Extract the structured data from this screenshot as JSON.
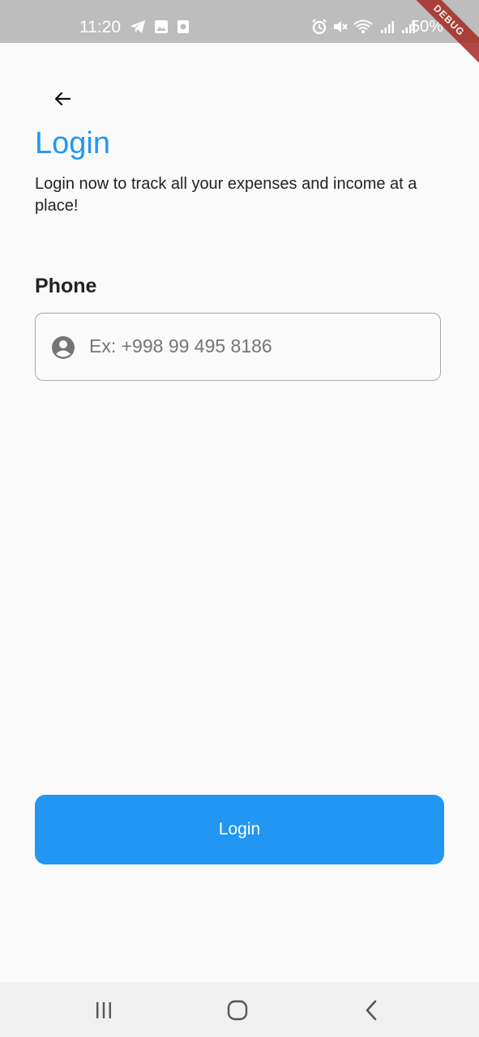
{
  "status_bar": {
    "time": "11:20",
    "battery": "50%",
    "debug_banner": "DEBUG",
    "left_icons": [
      "telegram-icon",
      "gallery-icon",
      "app-notification-icon"
    ],
    "right_icons": [
      "alarm-icon",
      "mute-icon",
      "wifi-icon",
      "signal-icon",
      "signal-icon"
    ]
  },
  "header": {
    "back_icon": "arrow-left-icon",
    "title": "Login",
    "subtitle": "Login now to track all your expenses and income at a place!"
  },
  "form": {
    "phone_label": "Phone",
    "phone_icon": "person-circle-icon",
    "phone_placeholder": "Ex: +998 99 495 8186",
    "phone_value": ""
  },
  "actions": {
    "login_label": "Login"
  },
  "nav_bar": {
    "buttons": [
      "recent-apps-icon",
      "home-icon",
      "back-icon"
    ]
  },
  "colors": {
    "accent": "#2196f3",
    "background": "#fafafa",
    "status_bar": "#bdbdbd",
    "text": "#222222"
  }
}
